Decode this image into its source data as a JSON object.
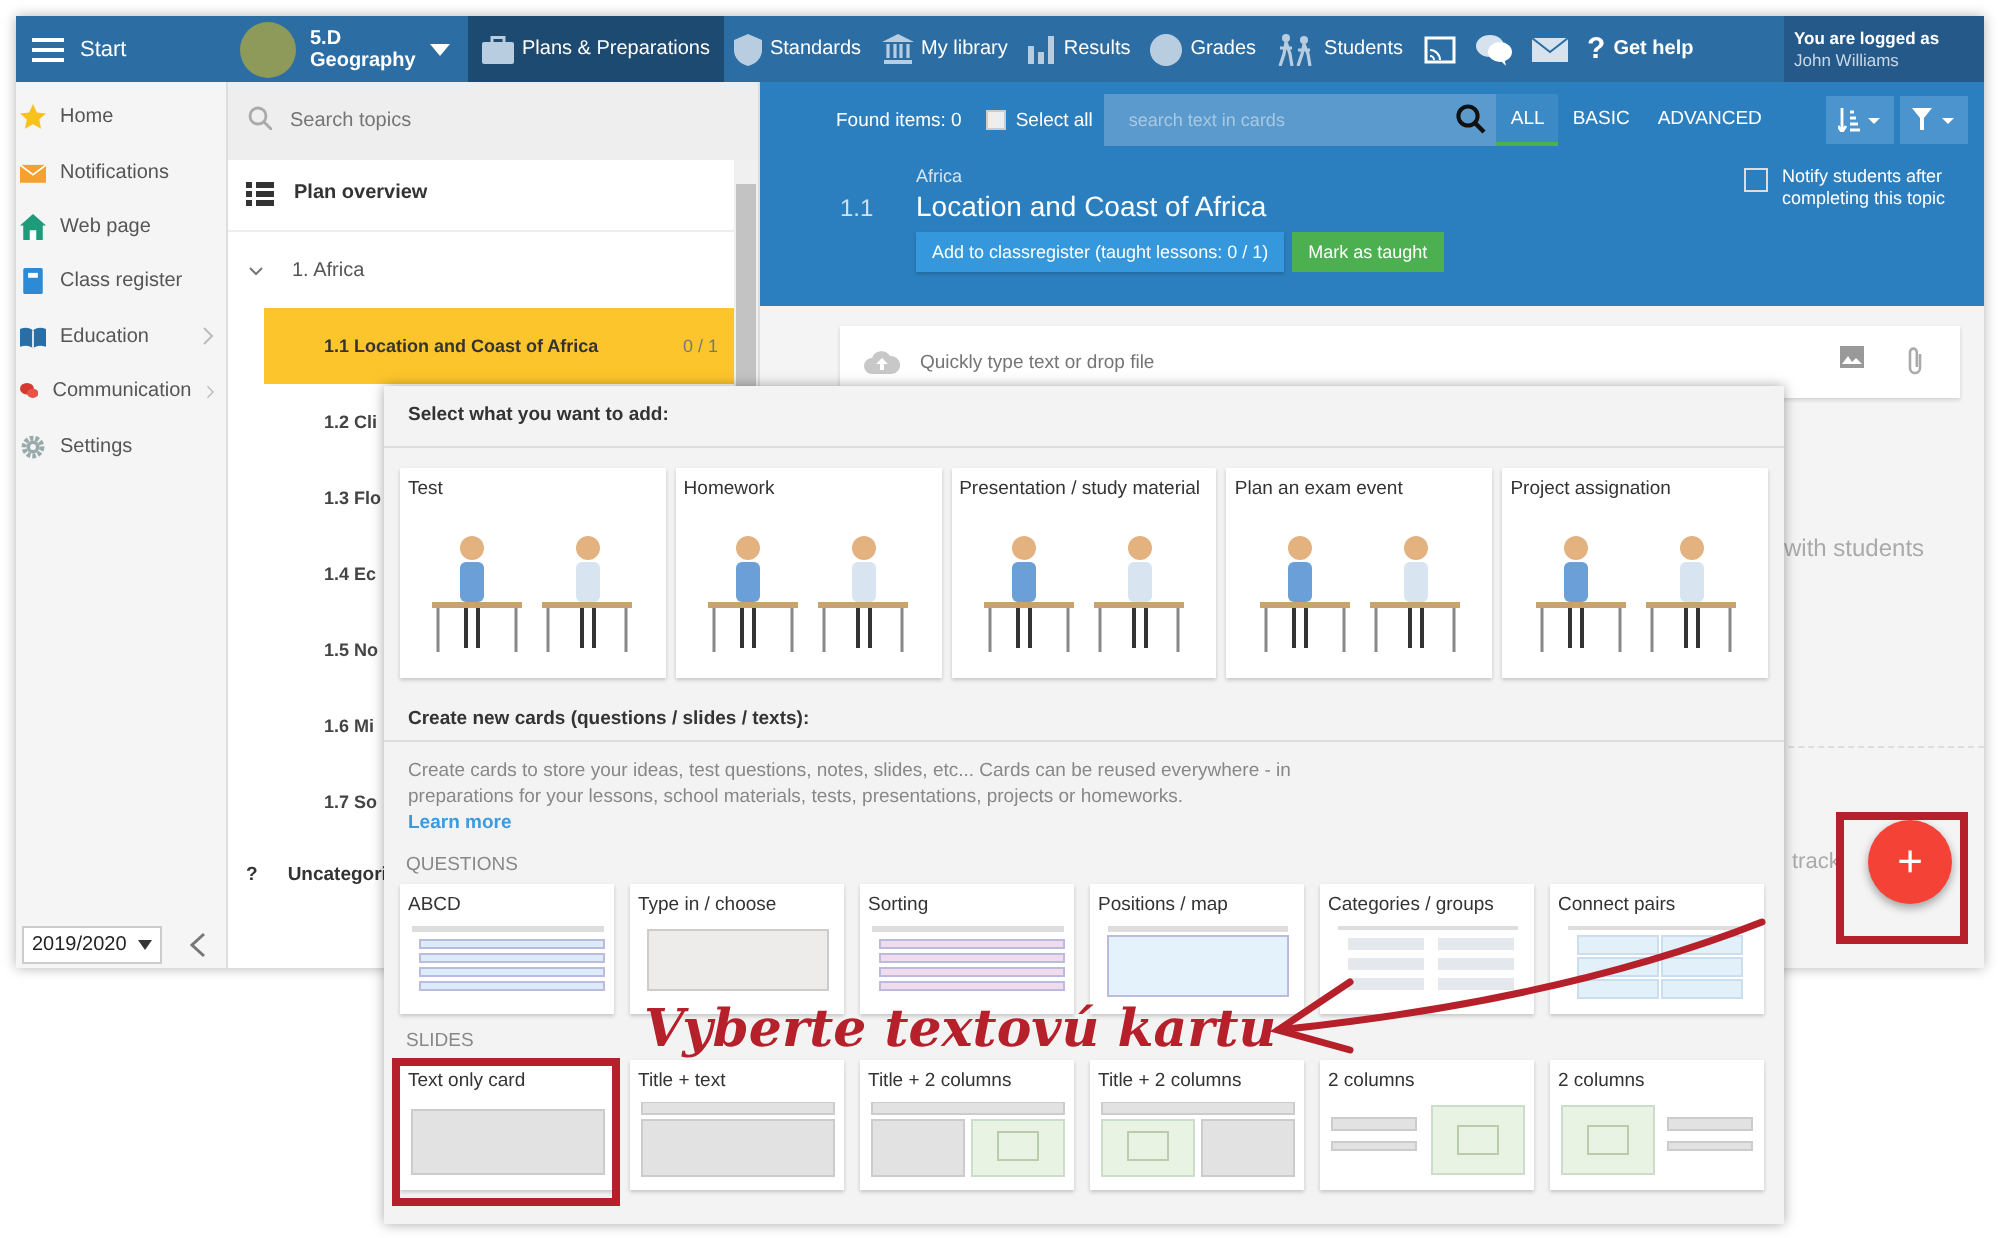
{
  "topbar": {
    "menu_label": "Start",
    "class_name": "5.D",
    "class_subject": "Geography",
    "nav": [
      {
        "kind": "briefcase",
        "label": "Plans & Preparations",
        "selected": true
      },
      {
        "kind": "shield",
        "label": "Standards",
        "selected": false
      },
      {
        "kind": "library",
        "label": "My library",
        "selected": false
      },
      {
        "kind": "bars",
        "label": "Results",
        "selected": false
      },
      {
        "kind": "grade",
        "label": "Grades",
        "selected": false
      },
      {
        "kind": "students",
        "label": "Students",
        "selected": false
      },
      {
        "kind": "cast",
        "selected": false
      },
      {
        "kind": "chat",
        "selected": false
      },
      {
        "kind": "mail",
        "selected": false
      },
      {
        "kind": "help",
        "glyph": "?",
        "label": "Get help",
        "selected": false
      }
    ],
    "user_caption": "You are logged as",
    "user_name": "John Williams"
  },
  "sidebar": {
    "items": [
      {
        "kind": "star",
        "label": "Home",
        "submenu": false
      },
      {
        "kind": "envelope",
        "label": "Notifications",
        "submenu": false
      },
      {
        "kind": "house",
        "label": "Web page",
        "submenu": false
      },
      {
        "kind": "book",
        "label": "Class register",
        "submenu": false
      },
      {
        "kind": "openbook",
        "label": "Education",
        "submenu": true
      },
      {
        "kind": "bubbles",
        "label": "Communication",
        "submenu": true
      },
      {
        "kind": "gear",
        "label": "Settings",
        "submenu": false
      }
    ],
    "year": "2019/2020"
  },
  "topics": {
    "search_placeholder": "Search topics",
    "overview": "Plan overview",
    "groups": [
      {
        "label": "1. Africa",
        "expanded": true,
        "children": [
          {
            "number": "1.1",
            "title": "Location and Coast of Africa",
            "count": "0 / 1",
            "selected": true
          },
          {
            "number": "1.2",
            "title": "Cli",
            "selected": false
          },
          {
            "number": "1.3",
            "title": "Flo",
            "selected": false
          },
          {
            "number": "1.4",
            "title": "Ec",
            "selected": false
          },
          {
            "number": "1.5",
            "title": "No",
            "selected": false
          },
          {
            "number": "1.6",
            "title": "Mi",
            "selected": false
          },
          {
            "number": "1.7",
            "title": "So",
            "selected": false
          }
        ]
      }
    ],
    "uncategorized_glyph": "?",
    "uncategorized": "Uncategori"
  },
  "content": {
    "found": "Found items: 0",
    "select_all": {
      "label": "Select all",
      "checked": false
    },
    "search_placeholder": "search text in cards",
    "levels": [
      {
        "label": "ALL",
        "selected": true
      },
      {
        "label": "BASIC",
        "selected": false
      },
      {
        "label": "ADVANCED",
        "selected": false
      }
    ],
    "breadcrumb": "Africa",
    "number": "1.1",
    "title": "Location and Coast of Africa",
    "classregister_button": "Add to classregister (taught lessons: 0 / 1)",
    "taught_button": "Mark as taught",
    "notify": {
      "label": "Notify students after completing this topic",
      "checked": false
    },
    "quick_placeholder": "Quickly type text or drop file",
    "hint_text": "with students",
    "hint_text_2": "track",
    "fab": "+"
  },
  "popup": {
    "heading": "Select what you want to add:",
    "activities": [
      {
        "label": "Test"
      },
      {
        "label": "Homework"
      },
      {
        "label": "Presentation / study material"
      },
      {
        "label": "Plan an exam event"
      },
      {
        "label": "Project assignation"
      }
    ],
    "cards_heading": "Create new cards (questions / slides / texts):",
    "description": "Create cards to store your ideas, test questions, notes, slides, etc... Cards can be reused everywhere - in preparations for your lessons, school materials, tests, presentations, projects or homeworks.",
    "learn_more": "Learn more",
    "questions_label": "QUESTIONS",
    "questions": [
      {
        "label": "ABCD",
        "kind": "abcd"
      },
      {
        "label": "Type in / choose",
        "kind": "input"
      },
      {
        "label": "Sorting",
        "kind": "sorting"
      },
      {
        "label": "Positions / map",
        "kind": "map"
      },
      {
        "label": "Categories / groups",
        "kind": "categories"
      },
      {
        "label": "Connect pairs",
        "kind": "pairs"
      }
    ],
    "slides_label": "SLIDES",
    "slides": [
      {
        "label": "Text only card",
        "kind": "text"
      },
      {
        "label": "Title + text",
        "kind": "title-text"
      },
      {
        "label": "Title + 2 columns",
        "kind": "title-img-right"
      },
      {
        "label": "Title + 2 columns",
        "kind": "title-img-left"
      },
      {
        "label": "2 columns",
        "kind": "img-right"
      },
      {
        "label": "2 columns",
        "kind": "img-left"
      }
    ]
  },
  "annotation": {
    "text": "Vyberte textovú kartu"
  }
}
